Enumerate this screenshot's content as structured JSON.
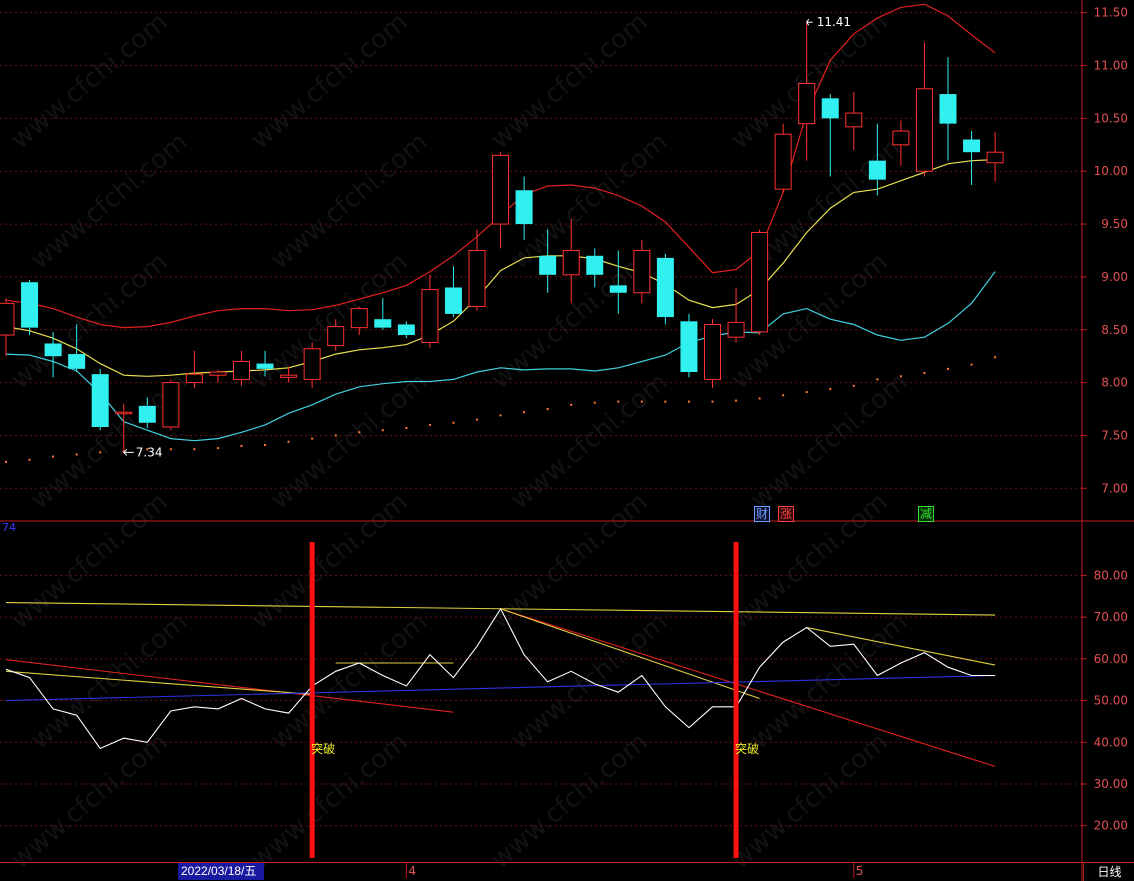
{
  "chart_data": {
    "type": "candlestick",
    "upper_panel": {
      "y_ticks": [
        "11.50",
        "11.00",
        "10.50",
        "10.00",
        "9.50",
        "9.00",
        "8.50",
        "8.00",
        "7.50",
        "7.00"
      ],
      "y_tick_values": [
        11.5,
        11.0,
        10.5,
        10.0,
        9.5,
        9.0,
        8.5,
        8.0,
        7.5,
        7.0
      ],
      "ylim": [
        6.7,
        11.62
      ],
      "grid": true,
      "candles": [
        {
          "o": 8.45,
          "h": 8.8,
          "l": 8.25,
          "c": 8.75
        },
        {
          "o": 8.95,
          "h": 8.97,
          "l": 8.45,
          "c": 8.52
        },
        {
          "o": 8.37,
          "h": 8.48,
          "l": 8.05,
          "c": 8.25
        },
        {
          "o": 8.27,
          "h": 8.55,
          "l": 8.1,
          "c": 8.13
        },
        {
          "o": 8.08,
          "h": 8.13,
          "l": 7.55,
          "c": 7.58
        },
        {
          "o": 7.72,
          "h": 7.8,
          "l": 7.34,
          "c": 7.72
        },
        {
          "o": 7.78,
          "h": 7.86,
          "l": 7.57,
          "c": 7.62
        },
        {
          "o": 7.58,
          "h": 8.03,
          "l": 7.55,
          "c": 8.0
        },
        {
          "o": 8.0,
          "h": 8.3,
          "l": 7.95,
          "c": 8.08
        },
        {
          "o": 8.07,
          "h": 8.12,
          "l": 8.0,
          "c": 8.1
        },
        {
          "o": 8.03,
          "h": 8.3,
          "l": 7.97,
          "c": 8.2
        },
        {
          "o": 8.18,
          "h": 8.3,
          "l": 8.06,
          "c": 8.13
        },
        {
          "o": 8.05,
          "h": 8.15,
          "l": 8.0,
          "c": 8.07
        },
        {
          "o": 8.03,
          "h": 8.38,
          "l": 7.95,
          "c": 8.32
        },
        {
          "o": 8.35,
          "h": 8.6,
          "l": 8.3,
          "c": 8.53
        },
        {
          "o": 8.52,
          "h": 8.72,
          "l": 8.45,
          "c": 8.7
        },
        {
          "o": 8.6,
          "h": 8.8,
          "l": 8.5,
          "c": 8.52
        },
        {
          "o": 8.55,
          "h": 8.58,
          "l": 8.42,
          "c": 8.45
        },
        {
          "o": 8.38,
          "h": 9.02,
          "l": 8.33,
          "c": 8.88
        },
        {
          "o": 8.9,
          "h": 9.1,
          "l": 8.62,
          "c": 8.65
        },
        {
          "o": 8.72,
          "h": 9.45,
          "l": 8.68,
          "c": 9.25
        },
        {
          "o": 9.5,
          "h": 10.18,
          "l": 9.27,
          "c": 10.15
        },
        {
          "o": 9.82,
          "h": 9.95,
          "l": 9.35,
          "c": 9.5
        },
        {
          "o": 9.2,
          "h": 9.45,
          "l": 8.85,
          "c": 9.02
        },
        {
          "o": 9.02,
          "h": 9.55,
          "l": 8.75,
          "c": 9.25
        },
        {
          "o": 9.2,
          "h": 9.27,
          "l": 8.9,
          "c": 9.02
        },
        {
          "o": 8.92,
          "h": 9.25,
          "l": 8.65,
          "c": 8.85
        },
        {
          "o": 8.85,
          "h": 9.35,
          "l": 8.75,
          "c": 9.25
        },
        {
          "o": 9.18,
          "h": 9.22,
          "l": 8.55,
          "c": 8.62
        },
        {
          "o": 8.58,
          "h": 8.65,
          "l": 8.05,
          "c": 8.1
        },
        {
          "o": 8.03,
          "h": 8.6,
          "l": 7.95,
          "c": 8.55
        },
        {
          "o": 8.43,
          "h": 8.9,
          "l": 8.38,
          "c": 8.57
        },
        {
          "o": 8.48,
          "h": 9.45,
          "l": 8.45,
          "c": 9.42
        },
        {
          "o": 9.83,
          "h": 10.45,
          "l": 9.8,
          "c": 10.35
        },
        {
          "o": 10.45,
          "h": 11.41,
          "l": 10.1,
          "c": 10.83
        },
        {
          "o": 10.69,
          "h": 10.73,
          "l": 9.95,
          "c": 10.5
        },
        {
          "o": 10.42,
          "h": 10.75,
          "l": 10.2,
          "c": 10.55
        },
        {
          "o": 10.1,
          "h": 10.45,
          "l": 9.77,
          "c": 9.92
        },
        {
          "o": 10.25,
          "h": 10.48,
          "l": 10.05,
          "c": 10.38
        },
        {
          "o": 10.0,
          "h": 11.22,
          "l": 9.95,
          "c": 10.78
        },
        {
          "o": 10.73,
          "h": 11.08,
          "l": 10.1,
          "c": 10.45
        },
        {
          "o": 10.3,
          "h": 10.38,
          "l": 9.87,
          "c": 10.18
        },
        {
          "o": 10.08,
          "h": 10.37,
          "l": 9.9,
          "c": 10.18
        }
      ],
      "annotations": [
        {
          "text": "11.41",
          "value": 11.41,
          "type": "high"
        },
        {
          "text": "7.34",
          "value": 7.34,
          "type": "low"
        }
      ],
      "event_flags": [
        {
          "text": "财",
          "color": "#6aa0ff",
          "bg": "#101030"
        },
        {
          "text": "涨",
          "color": "#ff4040",
          "bg": "#300808"
        },
        {
          "text": "减",
          "color": "#30e030",
          "bg": "#083008"
        }
      ],
      "bands": {
        "upper": [
          8.78,
          8.75,
          8.7,
          8.62,
          8.55,
          8.52,
          8.53,
          8.57,
          8.63,
          8.68,
          8.7,
          8.7,
          8.68,
          8.69,
          8.73,
          8.79,
          8.85,
          8.92,
          9.05,
          9.2,
          9.38,
          9.58,
          9.78,
          9.86,
          9.87,
          9.84,
          9.77,
          9.67,
          9.52,
          9.28,
          9.04,
          9.07,
          9.25,
          9.8,
          10.55,
          11.05,
          11.3,
          11.45,
          11.55,
          11.58,
          11.47,
          11.29,
          11.12
        ],
        "middle": [
          8.53,
          8.49,
          8.42,
          8.32,
          8.18,
          8.07,
          8.06,
          8.07,
          8.09,
          8.1,
          8.11,
          8.12,
          8.14,
          8.2,
          8.27,
          8.31,
          8.33,
          8.36,
          8.45,
          8.58,
          8.8,
          9.06,
          9.18,
          9.2,
          9.2,
          9.17,
          9.1,
          9.04,
          8.93,
          8.78,
          8.71,
          8.74,
          8.88,
          9.13,
          9.42,
          9.65,
          9.8,
          9.83,
          9.91,
          9.99,
          10.07,
          10.1,
          10.11
        ],
        "lower": [
          8.27,
          8.26,
          8.2,
          8.11,
          7.9,
          7.63,
          7.55,
          7.47,
          7.45,
          7.47,
          7.53,
          7.6,
          7.71,
          7.79,
          7.89,
          7.96,
          7.99,
          8.01,
          8.01,
          8.03,
          8.1,
          8.14,
          8.12,
          8.13,
          8.13,
          8.11,
          8.14,
          8.2,
          8.26,
          8.38,
          8.44,
          8.48,
          8.47,
          8.65,
          8.7,
          8.6,
          8.55,
          8.45,
          8.4,
          8.43,
          8.56,
          8.75,
          9.05
        ]
      },
      "sar_dots": [
        7.25,
        7.27,
        7.3,
        7.32,
        7.34,
        7.35,
        7.37,
        7.37,
        7.37,
        7.38,
        7.4,
        7.41,
        7.44,
        7.47,
        7.5,
        7.53,
        7.55,
        7.57,
        7.6,
        7.62,
        7.65,
        7.69,
        7.72,
        7.75,
        7.79,
        7.81,
        7.82,
        7.82,
        7.82,
        7.82,
        7.82,
        7.83,
        7.85,
        7.88,
        7.91,
        7.94,
        7.97,
        8.03,
        8.06,
        8.09,
        8.13,
        8.17,
        8.24
      ]
    },
    "lower_panel": {
      "corner_label": "74",
      "y_ticks": [
        "80.00",
        "70.00",
        "60.00",
        "50.00",
        "40.00",
        "30.00",
        "20.00"
      ],
      "y_tick_values": [
        80,
        70,
        60,
        50,
        40,
        30,
        20
      ],
      "ylim": [
        11.3,
        92.8
      ],
      "grid": true,
      "series": [
        {
          "values": [
            57.5,
            55.5,
            48,
            46.5,
            38.5,
            41,
            40,
            47.5,
            48.5,
            48,
            50.5,
            48,
            47,
            53.5,
            57,
            59,
            56,
            53.5,
            61,
            55.5,
            63,
            72,
            61,
            54.5,
            57,
            54,
            52,
            56,
            48.5,
            43.5,
            48.5,
            48.5,
            58,
            64,
            67.5,
            63,
            63.5,
            56,
            59,
            61.5,
            58,
            56,
            56
          ],
          "color": "#ffffff"
        }
      ],
      "trend_lines": [
        {
          "color": "#e0d040",
          "from": [
            0,
            73.5
          ],
          "to": [
            42,
            70.5
          ]
        },
        {
          "color": "#e02020",
          "from": [
            0,
            59.8
          ],
          "to": [
            19,
            47.2
          ]
        },
        {
          "color": "#e02020",
          "from": [
            21,
            72
          ],
          "to": [
            42,
            34.2
          ]
        },
        {
          "color": "#e0d040",
          "from": [
            0,
            57
          ],
          "to": [
            13,
            51.5
          ]
        },
        {
          "color": "#e0d040",
          "from": [
            14,
            59
          ],
          "to": [
            19,
            59
          ]
        },
        {
          "color": "#e0d040",
          "from": [
            21,
            72
          ],
          "to": [
            32,
            50.5
          ]
        },
        {
          "color": "#e0d040",
          "from": [
            34,
            67.5
          ],
          "to": [
            42,
            58.5
          ]
        },
        {
          "color": "#3030e0",
          "from": [
            0,
            50
          ],
          "to": [
            42,
            56
          ]
        }
      ],
      "signals": [
        {
          "index": 13,
          "text": "突破"
        },
        {
          "index": 31,
          "text": "突破"
        }
      ]
    },
    "x_labels": [
      {
        "index": 7,
        "text": "2022/03/18/五"
      },
      {
        "index": 17,
        "text": "4"
      },
      {
        "index": 36,
        "text": "5"
      }
    ],
    "period_tab": "日线",
    "watermark": "www.cfchi.com"
  }
}
